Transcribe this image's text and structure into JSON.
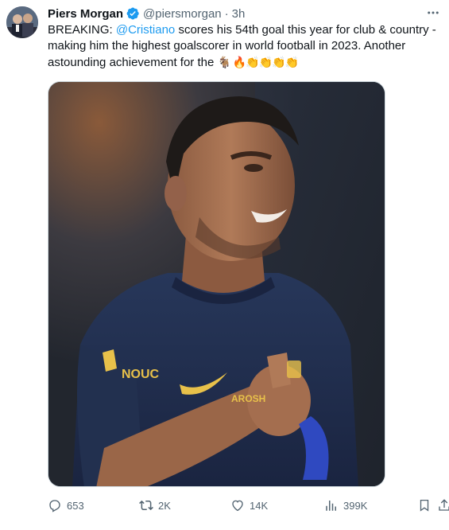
{
  "author": {
    "name": "Piers Morgan",
    "handle": "@piersmorgan",
    "separator": "·",
    "time": "3h"
  },
  "tweet": {
    "text_part1": "BREAKING: ",
    "mention": "@Cristiano",
    "text_part2": " scores his 54th goal this year for club & country - making him the highest goalscorer in world football in 2023. Another astounding achievement for the ",
    "emojis": "🐐 🔥👏👏👏👏"
  },
  "media": {
    "description": "Photo of footballer in navy Al Nassr jersey clenching fist at chest",
    "kit_sponsor_text": "AROSH",
    "club_text": "NOUC"
  },
  "actions": {
    "replies": "653",
    "reposts": "2K",
    "likes": "14K",
    "views": "399K"
  },
  "icons": {
    "verified": "verified-badge-icon",
    "more": "more-icon",
    "reply": "reply-icon",
    "repost": "repost-icon",
    "like": "heart-icon",
    "views": "views-icon",
    "bookmark": "bookmark-icon",
    "share": "share-icon"
  },
  "colors": {
    "accent": "#1d9bf0",
    "secondary_text": "#536471",
    "primary_text": "#0f1419"
  }
}
